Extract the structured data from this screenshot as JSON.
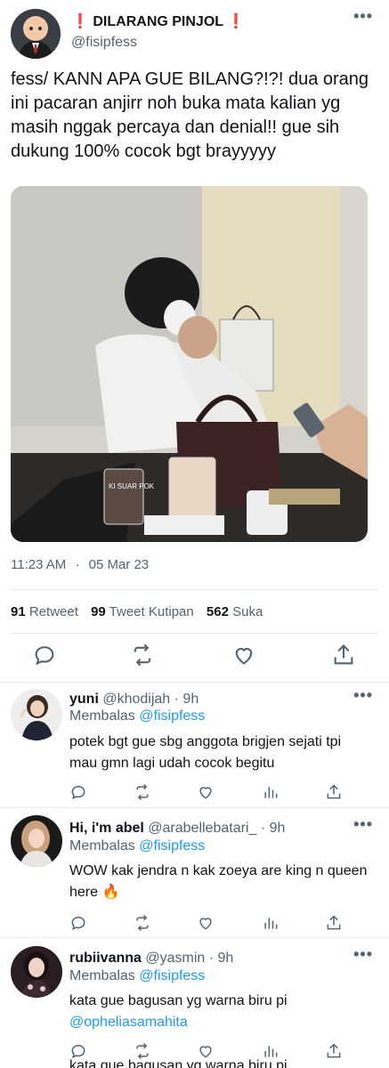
{
  "main_tweet": {
    "display_name": "DILARANG PINJOL",
    "name_prefix": "❗",
    "name_suffix": "❗",
    "handle": "@fisipfess",
    "text": "fess/ KANN APA GUE BILANG?!?! dua orang ini pacaran anjirr noh buka mata kalian yg masih nggak percaya dan denial!! gue sih dukung 100% cocok bgt brayyyyy",
    "photo_cup_text": "KI SUAR POK",
    "time": "11:23 AM",
    "date_sep": "·",
    "date": "05 Mar 23",
    "stats": {
      "retweets": "91",
      "retweets_label": "Retweet",
      "quotes": "99",
      "quotes_label": "Tweet Kutipan",
      "likes": "562",
      "likes_label": "Suka"
    },
    "more_glyph": "•••"
  },
  "replies": [
    {
      "name": "yuni",
      "handle": "@khodijah",
      "time": "· 9h",
      "replying_label": "Membalas",
      "replying_to": "@fisipfess",
      "text": "potek bgt gue sbg anggota brigjen sejati tpi mau gmn lagi udah cocok begitu"
    },
    {
      "name": "Hi, i'm abel",
      "handle": "@arabellebatari_",
      "time": "· 9h",
      "replying_label": "Membalas",
      "replying_to": "@fisipfess",
      "text": "WOW kak jendra n kak zoeya are king n queen here 🔥"
    },
    {
      "name": "rubiivanna",
      "handle": "@yasmin",
      "time": "· 9h",
      "replying_label": "Membalas",
      "replying_to": "@fisipfess",
      "text": "kata gue bagusan yg warna biru pi",
      "mention": "@opheliasamahita"
    }
  ],
  "clipped_text": "kata gue bagusan yg warna biru pi",
  "colors": {
    "accent": "#1d9bf0",
    "muted": "#536471",
    "text": "#0f1419",
    "alert": "#e0245e"
  },
  "icons": [
    "reply-icon",
    "retweet-icon",
    "like-icon",
    "share-icon",
    "views-icon",
    "more-icon"
  ]
}
